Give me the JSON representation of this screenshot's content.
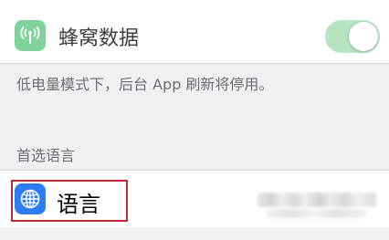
{
  "cellular": {
    "label": "蜂窝数据",
    "icon": "antenna-icon",
    "toggle_on": true,
    "colors": {
      "icon_bg": "#7fd39a",
      "toggle_bg": "#b5e6c0"
    }
  },
  "footnote": "低电量模式下，后台 App 刷新将停用。",
  "preferred_language_section": {
    "header": "首选语言",
    "language_row": {
      "label": "语言",
      "icon": "globe-icon",
      "colors": {
        "icon_bg": "#2f7df6",
        "highlight_border": "#c0282f"
      }
    }
  }
}
